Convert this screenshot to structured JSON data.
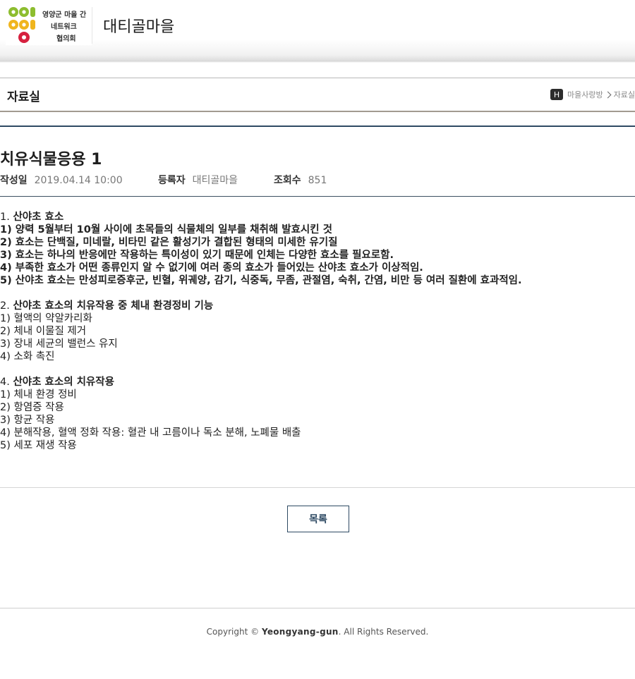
{
  "header": {
    "logo": {
      "line1": "영양군 마을 간",
      "line2": "네트워크",
      "line3": "협의회",
      "colors": [
        "#8dbd2f",
        "#f0b51e",
        "#d6213f"
      ]
    },
    "site_title": "대티골마을"
  },
  "board": {
    "title": "자료실",
    "breadcrumb": {
      "home_label": "H",
      "items": [
        "마을사랑방",
        "자료실"
      ]
    }
  },
  "post": {
    "title": "치유식물응용 1",
    "meta": {
      "date_label": "작성일",
      "date_value": "2019.04.14 10:00",
      "author_label": "등록자",
      "author_value": "대티골마을",
      "views_label": "조회수",
      "views_value": "851"
    },
    "content": {
      "sections": [
        {
          "heading_num": "1.",
          "heading": "산야초 효소",
          "lines": [
            "1) 양력 5월부터 10월 사이에 초목들의 식물체의 일부를 채취해 발효시킨 것",
            "2) 효소는 단백질, 미네랄, 비타민 같은 활성기가 결합된 형태의 미세한 유기질",
            "3) 효소는 하나의 반응에만 작용하는 특이성이 있기 때문에 인체는 다양한 효소를 필요로함.",
            "4) 부족한 효소가 어떤 종류인지 알 수 없기에 여러 종의 효소가 들어있는 산야초 효소가 이상적임.",
            "5) 산야초 효소는 만성피로증후군, 빈혈, 위궤양, 감기, 식중독, 무좀, 관절염, 숙취, 간염, 비만 등 여러 질환에 효과적임."
          ]
        },
        {
          "heading_num": "2.",
          "heading": "산야초 효소의 치유작용 중 체내 환경정비 기능",
          "lines": [
            "1) 혈액의 약알카리화",
            "2) 체내 이물질 제거",
            "3) 장내 세균의 밸런스 유지",
            "4) 소화 촉진"
          ]
        },
        {
          "heading_num": "4.",
          "heading": "산야초 효소의 치유작용",
          "lines": [
            "1) 체내 환경 정비",
            "2) 항염증 작용",
            "3) 항균 작용",
            "4) 분해작용, 혈액 정화 작용: 혈관 내 고름이나 독소 분해, 노폐물 배출",
            "5) 세포 재생 작용"
          ]
        }
      ]
    }
  },
  "actions": {
    "list_button": "목록"
  },
  "footer": {
    "prefix": "Copyright © ",
    "brand": "Yeongyang-gun",
    "suffix": ". All Rights Reserved."
  }
}
